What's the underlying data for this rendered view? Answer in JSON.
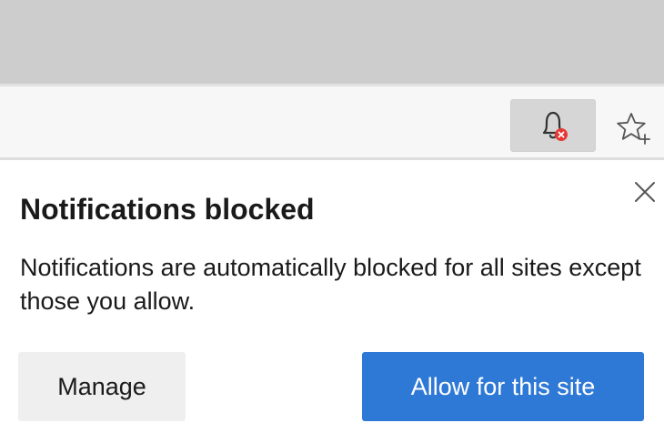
{
  "toolbar": {
    "notification_icon": "bell-blocked-icon",
    "favorite_icon": "star-add-icon",
    "badge_color": "#e53935"
  },
  "popup": {
    "title": "Notifications blocked",
    "message": "Notifications are automatically blocked for all sites except those you allow.",
    "close_icon": "close-icon",
    "manage_label": "Manage",
    "allow_label": "Allow for this site",
    "accent_color": "#2f79d6"
  }
}
